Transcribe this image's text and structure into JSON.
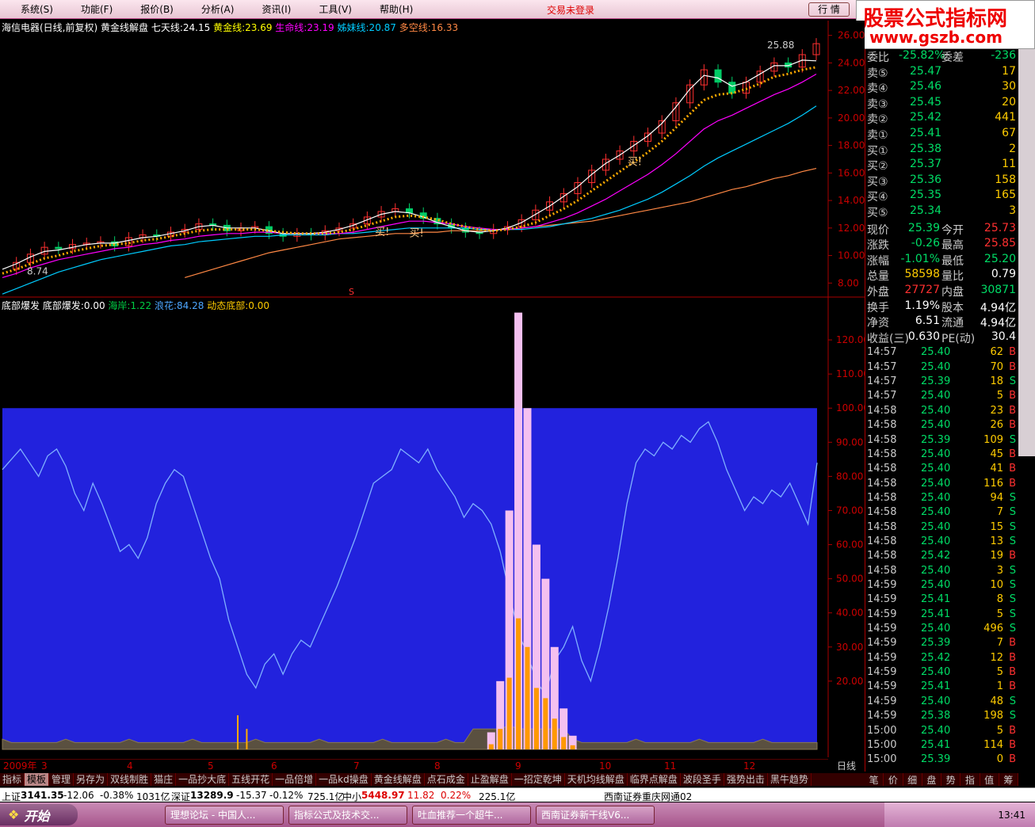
{
  "menu": {
    "items": [
      "系统(S)",
      "功能(F)",
      "报价(B)",
      "分析(A)",
      "资讯(I)",
      "工具(V)",
      "帮助(H)"
    ],
    "status": "交易未登录",
    "quote_button": "行 情"
  },
  "logo": {
    "line1": "股票公式指标网",
    "line2": "www.gszb.com"
  },
  "main_legend": {
    "stock": "海信电器(日线,前复权)",
    "indicator": "黄金线解盘",
    "items": [
      {
        "label": "七天线:",
        "value": "24.15",
        "color": "#ffffff"
      },
      {
        "label": "黄金线:",
        "value": "23.69",
        "color": "#ffff00"
      },
      {
        "label": "生命线:",
        "value": "23.19",
        "color": "#ff00ff"
      },
      {
        "label": "姊妹线:",
        "value": "20.87",
        "color": "#00ccff"
      },
      {
        "label": "多空线:",
        "value": "16.33",
        "color": "#ff8844"
      }
    ]
  },
  "main_chart": {
    "price_axis": [
      "26.00",
      "24.00",
      "22.00",
      "20.00",
      "18.00",
      "16.00",
      "14.00",
      "12.00",
      "10.00",
      "8.00"
    ],
    "price_ylim": [
      7.5,
      26.5
    ],
    "high_label": "25.88",
    "low_label": "8.74",
    "buy_markers": [
      "买!",
      "买!",
      "买!"
    ],
    "s_marker": "S",
    "series": {
      "close": [
        9.0,
        9.5,
        10.1,
        10.6,
        10.5,
        10.8,
        10.9,
        11.0,
        10.7,
        11.3,
        11.5,
        11.4,
        11.7,
        11.9,
        12.3,
        12.2,
        11.8,
        12.0,
        12.1,
        11.6,
        11.4,
        11.6,
        11.5,
        11.8,
        12.0,
        12.3,
        12.8,
        13.2,
        13.4,
        13.1,
        12.7,
        12.3,
        12.0,
        11.7,
        11.6,
        11.9,
        12.1,
        12.6,
        13.3,
        13.9,
        14.5,
        15.3,
        16.2,
        17.0,
        17.6,
        18.3,
        18.9,
        19.8,
        21.1,
        22.4,
        23.5,
        22.6,
        21.8,
        22.6,
        23.4,
        24.0,
        23.7,
        24.6,
        25.4
      ],
      "ma_white": [
        9.0,
        9.4,
        9.9,
        10.3,
        10.4,
        10.6,
        10.8,
        10.9,
        10.9,
        11.1,
        11.3,
        11.4,
        11.6,
        11.8,
        12.1,
        12.2,
        12.0,
        12.0,
        12.0,
        11.8,
        11.6,
        11.6,
        11.6,
        11.7,
        11.9,
        12.2,
        12.6,
        13.0,
        13.2,
        13.1,
        12.8,
        12.4,
        12.1,
        11.8,
        11.7,
        11.8,
        12.0,
        12.4,
        13.0,
        13.6,
        14.3,
        15.0,
        15.9,
        16.7,
        17.3,
        18.0,
        18.7,
        19.6,
        20.8,
        22.1,
        23.1,
        22.9,
        22.3,
        22.6,
        23.2,
        23.8,
        23.8,
        24.2,
        24.15
      ],
      "ma_gold": [
        8.7,
        9.0,
        9.4,
        9.8,
        10.0,
        10.3,
        10.5,
        10.7,
        10.8,
        10.9,
        11.1,
        11.2,
        11.4,
        11.6,
        11.8,
        11.9,
        11.9,
        11.9,
        11.9,
        11.8,
        11.7,
        11.6,
        11.6,
        11.6,
        11.7,
        11.9,
        12.2,
        12.5,
        12.8,
        12.9,
        12.8,
        12.6,
        12.3,
        12.1,
        11.9,
        11.8,
        11.9,
        12.1,
        12.4,
        12.9,
        13.4,
        14.0,
        14.7,
        15.4,
        16.1,
        16.8,
        17.5,
        18.3,
        19.3,
        20.3,
        21.3,
        21.7,
        21.8,
        22.1,
        22.5,
        23.0,
        23.2,
        23.5,
        23.69
      ],
      "ma_magenta": [
        8.4,
        8.7,
        9.1,
        9.4,
        9.7,
        9.9,
        10.1,
        10.3,
        10.5,
        10.6,
        10.8,
        10.9,
        11.1,
        11.2,
        11.4,
        11.5,
        11.6,
        11.6,
        11.7,
        11.7,
        11.6,
        11.6,
        11.6,
        11.6,
        11.6,
        11.7,
        11.9,
        12.1,
        12.3,
        12.5,
        12.5,
        12.4,
        12.3,
        12.1,
        12.0,
        11.9,
        11.9,
        12.0,
        12.1,
        12.4,
        12.7,
        13.1,
        13.6,
        14.1,
        14.7,
        15.3,
        15.9,
        16.6,
        17.4,
        18.3,
        19.2,
        19.8,
        20.2,
        20.7,
        21.2,
        21.7,
        22.1,
        22.6,
        23.19
      ],
      "ma_cyan": [
        7.2,
        7.6,
        8.0,
        8.4,
        8.8,
        9.1,
        9.4,
        9.7,
        9.9,
        10.1,
        10.3,
        10.5,
        10.7,
        10.8,
        11.0,
        11.1,
        11.2,
        11.3,
        11.4,
        11.4,
        11.5,
        11.5,
        11.5,
        11.5,
        11.6,
        11.6,
        11.7,
        11.8,
        11.9,
        12.0,
        12.0,
        12.0,
        12.0,
        12.0,
        11.9,
        11.9,
        11.9,
        11.9,
        12.0,
        12.1,
        12.3,
        12.5,
        12.7,
        13.0,
        13.3,
        13.7,
        14.1,
        14.6,
        15.2,
        15.8,
        16.5,
        17.1,
        17.6,
        18.1,
        18.6,
        19.1,
        19.6,
        20.2,
        20.87
      ],
      "ma_orange": [
        null,
        null,
        null,
        null,
        null,
        null,
        null,
        null,
        null,
        null,
        null,
        null,
        null,
        8.4,
        8.7,
        9.0,
        9.3,
        9.6,
        9.9,
        10.2,
        10.4,
        10.6,
        10.8,
        11.0,
        11.2,
        11.3,
        11.4,
        11.5,
        11.6,
        11.6,
        11.7,
        11.7,
        11.8,
        11.8,
        11.8,
        11.9,
        11.9,
        12.0,
        12.1,
        12.2,
        12.3,
        12.4,
        12.5,
        12.7,
        12.9,
        13.1,
        13.3,
        13.5,
        13.7,
        13.9,
        14.2,
        14.5,
        14.8,
        15.0,
        15.3,
        15.6,
        15.8,
        16.1,
        16.33
      ]
    }
  },
  "sub_legend": {
    "name": "底部爆发",
    "items": [
      {
        "label": "底部爆发:",
        "value": "0.00",
        "color": "#ffffff"
      },
      {
        "label": "海岸:",
        "value": "1.22",
        "color": "#00cc44"
      },
      {
        "label": "浪花:",
        "value": "84.28",
        "color": "#4da6ff"
      },
      {
        "label": "动态底部:",
        "value": "0.00",
        "color": "#ffcc00"
      }
    ]
  },
  "sub_chart": {
    "axis": [
      "120.00",
      "110.00",
      "100.00",
      "90.00",
      "80.00",
      "70.00",
      "60.00",
      "50.00",
      "40.00",
      "30.00",
      "20.00"
    ],
    "ylim": [
      0,
      130
    ],
    "band_top": 100,
    "wave": [
      82,
      85,
      88,
      84,
      80,
      86,
      88,
      83,
      75,
      70,
      78,
      72,
      65,
      58,
      60,
      56,
      62,
      72,
      78,
      82,
      80,
      72,
      64,
      56,
      50,
      38,
      30,
      22,
      18,
      25,
      28,
      22,
      28,
      32,
      30,
      36,
      42,
      48,
      55,
      62,
      70,
      78,
      80,
      82,
      88,
      86,
      84,
      88,
      82,
      78,
      74,
      68,
      72,
      70,
      66,
      58,
      46,
      34,
      28,
      20,
      16,
      26,
      30,
      36,
      26,
      20,
      30,
      42,
      56,
      72,
      84,
      88,
      86,
      90,
      88,
      92,
      90,
      94,
      96,
      90,
      82,
      76,
      70,
      74,
      72,
      76,
      74,
      78,
      72,
      66,
      84
    ],
    "spike": [
      0,
      0,
      0,
      0,
      0,
      0,
      0,
      0,
      0,
      0,
      0,
      0,
      0,
      0,
      0,
      0,
      0,
      0,
      0,
      0,
      0,
      0,
      0,
      0,
      0,
      0,
      0,
      0,
      0,
      0,
      0,
      0,
      0,
      0,
      0,
      0,
      0,
      0,
      0,
      0,
      0,
      0,
      0,
      0,
      0,
      0,
      0,
      0,
      0,
      0,
      0,
      0,
      0,
      0,
      5,
      20,
      70,
      128,
      100,
      60,
      50,
      30,
      12,
      4,
      0,
      0,
      0,
      0,
      0,
      0,
      0,
      0,
      0,
      0,
      0,
      0,
      0,
      0,
      0,
      0,
      0,
      0,
      0,
      0,
      0,
      0,
      0,
      0,
      0,
      0,
      0
    ],
    "months": [
      "2009年",
      "3",
      "4",
      "5",
      "6",
      "7",
      "8",
      "9",
      "10",
      "11",
      "12"
    ],
    "period": "日线"
  },
  "order_book": {
    "top": {
      "label": "委比",
      "value": "-25.82%",
      "label2": "委差",
      "value2": "-236"
    },
    "asks": [
      {
        "label": "卖⑤",
        "price": "25.47",
        "vol": "17"
      },
      {
        "label": "卖④",
        "price": "25.46",
        "vol": "30"
      },
      {
        "label": "卖③",
        "price": "25.45",
        "vol": "20"
      },
      {
        "label": "卖②",
        "price": "25.42",
        "vol": "441"
      },
      {
        "label": "卖①",
        "price": "25.41",
        "vol": "67"
      }
    ],
    "bids": [
      {
        "label": "买①",
        "price": "25.38",
        "vol": "2"
      },
      {
        "label": "买②",
        "price": "25.37",
        "vol": "11"
      },
      {
        "label": "买③",
        "price": "25.36",
        "vol": "158"
      },
      {
        "label": "买④",
        "price": "25.35",
        "vol": "165"
      },
      {
        "label": "买⑤",
        "price": "25.34",
        "vol": "3"
      }
    ]
  },
  "stats": [
    {
      "l1": "现价",
      "v1": "25.39",
      "l2": "今开",
      "v2": "25.73"
    },
    {
      "l1": "涨跌",
      "v1": "-0.26",
      "l2": "最高",
      "v2": "25.85"
    },
    {
      "l1": "涨幅",
      "v1": "-1.01%",
      "l2": "最低",
      "v2": "25.20"
    },
    {
      "l1": "总量",
      "v1": "58598",
      "l2": "量比",
      "v2": "0.79"
    },
    {
      "l1": "外盘",
      "v1": "27727",
      "l2": "内盘",
      "v2": "30871"
    },
    {
      "l1": "换手",
      "v1": "1.19%",
      "l2": "股本",
      "v2": "4.94亿"
    },
    {
      "l1": "净资",
      "v1": "6.51",
      "l2": "流通",
      "v2": "4.94亿"
    },
    {
      "l1": "收益(三)",
      "v1": "0.630",
      "l2": "PE(动)",
      "v2": "30.4"
    }
  ],
  "ticks": [
    [
      "14:57",
      "25.40",
      "62",
      "B"
    ],
    [
      "14:57",
      "25.40",
      "70",
      "B"
    ],
    [
      "14:57",
      "25.39",
      "18",
      "S"
    ],
    [
      "14:57",
      "25.40",
      "5",
      "B"
    ],
    [
      "14:58",
      "25.40",
      "23",
      "B"
    ],
    [
      "14:58",
      "25.40",
      "26",
      "B"
    ],
    [
      "14:58",
      "25.39",
      "109",
      "S"
    ],
    [
      "14:58",
      "25.40",
      "45",
      "B"
    ],
    [
      "14:58",
      "25.40",
      "41",
      "B"
    ],
    [
      "14:58",
      "25.40",
      "116",
      "B"
    ],
    [
      "14:58",
      "25.40",
      "94",
      "S"
    ],
    [
      "14:58",
      "25.40",
      "7",
      "S"
    ],
    [
      "14:58",
      "25.40",
      "15",
      "S"
    ],
    [
      "14:58",
      "25.40",
      "13",
      "S"
    ],
    [
      "14:58",
      "25.42",
      "19",
      "B"
    ],
    [
      "14:58",
      "25.40",
      "3",
      "S"
    ],
    [
      "14:59",
      "25.40",
      "10",
      "S"
    ],
    [
      "14:59",
      "25.41",
      "8",
      "S"
    ],
    [
      "14:59",
      "25.41",
      "5",
      "S"
    ],
    [
      "14:59",
      "25.40",
      "496",
      "S"
    ],
    [
      "14:59",
      "25.39",
      "7",
      "B"
    ],
    [
      "14:59",
      "25.42",
      "12",
      "B"
    ],
    [
      "14:59",
      "25.40",
      "5",
      "B"
    ],
    [
      "14:59",
      "25.41",
      "1",
      "B"
    ],
    [
      "14:59",
      "25.40",
      "48",
      "S"
    ],
    [
      "14:59",
      "25.38",
      "198",
      "S"
    ],
    [
      "15:00",
      "25.40",
      "5",
      "B"
    ],
    [
      "15:00",
      "25.41",
      "114",
      "B"
    ],
    [
      "15:00",
      "25.39",
      "0",
      "B"
    ]
  ],
  "tabs": [
    "指标",
    "模板",
    "管理",
    "另存为",
    "双线制胜",
    "猫庄",
    "一品抄大底",
    "五线开花",
    "一品倍增",
    "一品kd操盘",
    "黄金线解盘",
    "点石成金",
    "止盈解盘",
    "一招定乾坤",
    "天机均线解盘",
    "临界点解盘",
    "波段圣手",
    "强势出击",
    "黑牛趋势"
  ],
  "right_tabs": [
    "笔",
    "价",
    "细",
    "盘",
    "势",
    "指",
    "值",
    "筹"
  ],
  "indexbar": {
    "sh_label": "上证",
    "sh": "3141.35",
    "sh_chg": "-12.06",
    "sh_pct": "-0.38%",
    "sh_amt": "1031亿",
    "sz_label": "深证",
    "sz": "13289.9",
    "sz_chg": "-15.37",
    "sz_pct": "-0.12%",
    "sz_amt": "725.1亿",
    "zx_label": "中小",
    "zx": "5448.97",
    "zx_chg": "11.82",
    "zx_pct": "0.22%",
    "zx_amt": "225.1亿",
    "broker": "西南证券重庆网通02"
  },
  "taskbar": {
    "start": "开始",
    "tasks": [
      "理想论坛 - 中国人...",
      "指标公式及技术交...",
      "吐血推荐一个超牛...",
      "西南证券新干线V6..."
    ],
    "clock": "13:41"
  }
}
